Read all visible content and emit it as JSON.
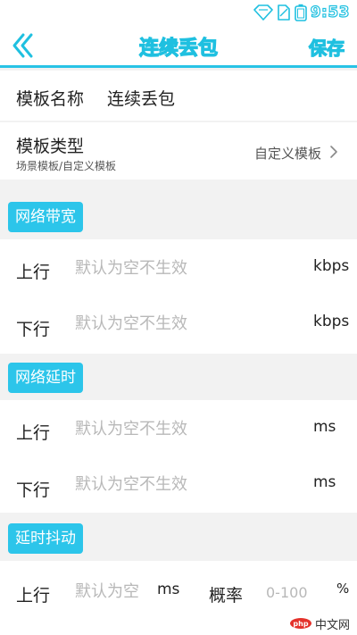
{
  "status_bar": {
    "time": "9:53"
  },
  "nav": {
    "title": "连续丢包",
    "save_label": "保存"
  },
  "template_name": {
    "label": "模板名称",
    "value": "连续丢包"
  },
  "template_type": {
    "label": "模板类型",
    "hint": "场景模板/自定义模板",
    "value": "自定义模板"
  },
  "bandwidth": {
    "title": "网络带宽",
    "uplink": {
      "label": "上行",
      "placeholder": "默认为空不生效",
      "unit": "kbps"
    },
    "downlink": {
      "label": "下行",
      "placeholder": "默认为空不生效",
      "unit": "kbps"
    }
  },
  "latency": {
    "title": "网络延时",
    "uplink": {
      "label": "上行",
      "placeholder": "默认为空不生效",
      "unit": "ms"
    },
    "downlink": {
      "label": "下行",
      "placeholder": "默认为空不生效",
      "unit": "ms"
    }
  },
  "jitter": {
    "title": "延时抖动",
    "uplink": {
      "label": "上行",
      "placeholder": "默认为空",
      "unit": "ms",
      "prob_label": "概率",
      "prob_placeholder": "0-100",
      "prob_unit": "%"
    }
  },
  "watermark": {
    "text": "中文网",
    "brand": "php"
  },
  "colors": {
    "accent": "#2cc5ea",
    "placeholder": "#b8b8b8"
  },
  "icons": [
    "wifi-icon",
    "sim-icon",
    "battery-icon",
    "back-chevron-icon",
    "chevron-right-icon"
  ]
}
